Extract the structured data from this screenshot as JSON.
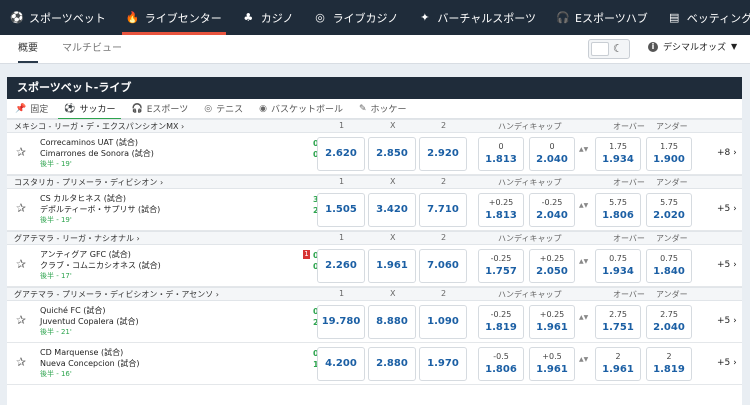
{
  "nav": [
    {
      "icon": "soccer-ball-icon",
      "glyph": "⚽",
      "label": "スポーツベット"
    },
    {
      "icon": "flame-icon",
      "glyph": "🔥",
      "label": "ライブセンター",
      "active": true
    },
    {
      "icon": "casino-icon",
      "glyph": "♣",
      "label": "カジノ"
    },
    {
      "icon": "live-casino-icon",
      "glyph": "◎",
      "label": "ライブカジノ"
    },
    {
      "icon": "virtual-sports-icon",
      "glyph": "✦",
      "label": "バーチャルスポーツ"
    },
    {
      "icon": "headset-icon",
      "glyph": "🎧",
      "label": "Eスポーツハブ"
    },
    {
      "icon": "document-icon",
      "glyph": "▤",
      "label": "ベッティングリソー"
    }
  ],
  "subtabs": {
    "overview": "概要",
    "multiview": "マルチビュー"
  },
  "odds_format": "デシマルオッズ",
  "panel_title": "スポーツベット-ライブ",
  "sports": [
    {
      "icon": "pin-icon",
      "glyph": "📌",
      "label": "固定"
    },
    {
      "icon": "soccer-icon",
      "glyph": "⚽",
      "label": "サッカー",
      "active": true
    },
    {
      "icon": "esports-icon",
      "glyph": "🎧",
      "label": "Eスポーツ"
    },
    {
      "icon": "tennis-icon",
      "glyph": "◎",
      "label": "テニス"
    },
    {
      "icon": "basketball-icon",
      "glyph": "◉",
      "label": "バスケットボール"
    },
    {
      "icon": "hockey-icon",
      "glyph": "✎",
      "label": "ホッケー"
    }
  ],
  "col_headers": {
    "one": "1",
    "x": "X",
    "two": "2",
    "handicap": "ハンディキャップ",
    "over": "オーバー",
    "under": "アンダー"
  },
  "leagues": [
    {
      "name": "メキシコ - リーガ・デ・エクスパンシオンMX",
      "matches": [
        {
          "home": "Correcaminos UAT (試合)",
          "away": "Cimarrones de Sonora (試合)",
          "time": "後半 - 19'",
          "score_home": "0",
          "score_away": "0",
          "o1": "2.620",
          "ox": "2.850",
          "o2": "2.920",
          "h1_line": "0",
          "h1": "1.813",
          "h2_line": "0",
          "h2": "2.040",
          "ov_line": "1.75",
          "ov": "1.934",
          "un_line": "1.75",
          "un": "1.900",
          "more": "+8"
        }
      ]
    },
    {
      "name": "コスタリカ - プリメーラ・ディビシオン",
      "matches": [
        {
          "home": "CS カルタヒネス (試合)",
          "away": "デポルティーボ・サプリサ (試合)",
          "time": "後半 - 19'",
          "score_home": "3",
          "score_away": "2",
          "o1": "1.505",
          "ox": "3.420",
          "o2": "7.710",
          "h1_line": "+0.25",
          "h1": "1.813",
          "h2_line": "-0.25",
          "h2": "2.040",
          "ov_line": "5.75",
          "ov": "1.806",
          "un_line": "5.75",
          "un": "2.020",
          "more": "+5"
        }
      ]
    },
    {
      "name": "グアテマラ - リーガ・ナシオナル",
      "matches": [
        {
          "home": "アンティグア GFC (試合)",
          "away": "クラブ・コムニカシオネス (試合)",
          "time": "後半 - 17'",
          "score_home": "0",
          "score_away": "0",
          "red_card": "1",
          "o1": "2.260",
          "ox": "1.961",
          "o2": "7.060",
          "h1_line": "-0.25",
          "h1": "1.757",
          "h2_line": "+0.25",
          "h2": "2.050",
          "ov_line": "0.75",
          "ov": "1.934",
          "un_line": "0.75",
          "un": "1.840",
          "more": "+5"
        }
      ]
    },
    {
      "name": "グアテマラ - プリメーラ・ディビシオン・デ・アセンソ",
      "matches": [
        {
          "home": "Quiché FC (試合)",
          "away": "Juventud Copalera (試合)",
          "time": "後半 - 21'",
          "score_home": "0",
          "score_away": "2",
          "o1": "19.780",
          "ox": "8.880",
          "o2": "1.090",
          "h1_line": "-0.25",
          "h1": "1.819",
          "h2_line": "+0.25",
          "h2": "1.961",
          "ov_line": "2.75",
          "ov": "1.751",
          "un_line": "2.75",
          "un": "2.040",
          "more": "+5"
        },
        {
          "home": "CD Marquense (試合)",
          "away": "Nueva Concepcion (試合)",
          "time": "後半 - 16'",
          "score_home": "0",
          "score_away": "1",
          "o1": "4.200",
          "ox": "2.880",
          "o2": "1.970",
          "h1_line": "-0.5",
          "h1": "1.806",
          "h2_line": "+0.5",
          "h2": "1.961",
          "ov_line": "2",
          "ov": "1.961",
          "un_line": "2",
          "un": "1.819",
          "more": "+5"
        }
      ]
    }
  ]
}
